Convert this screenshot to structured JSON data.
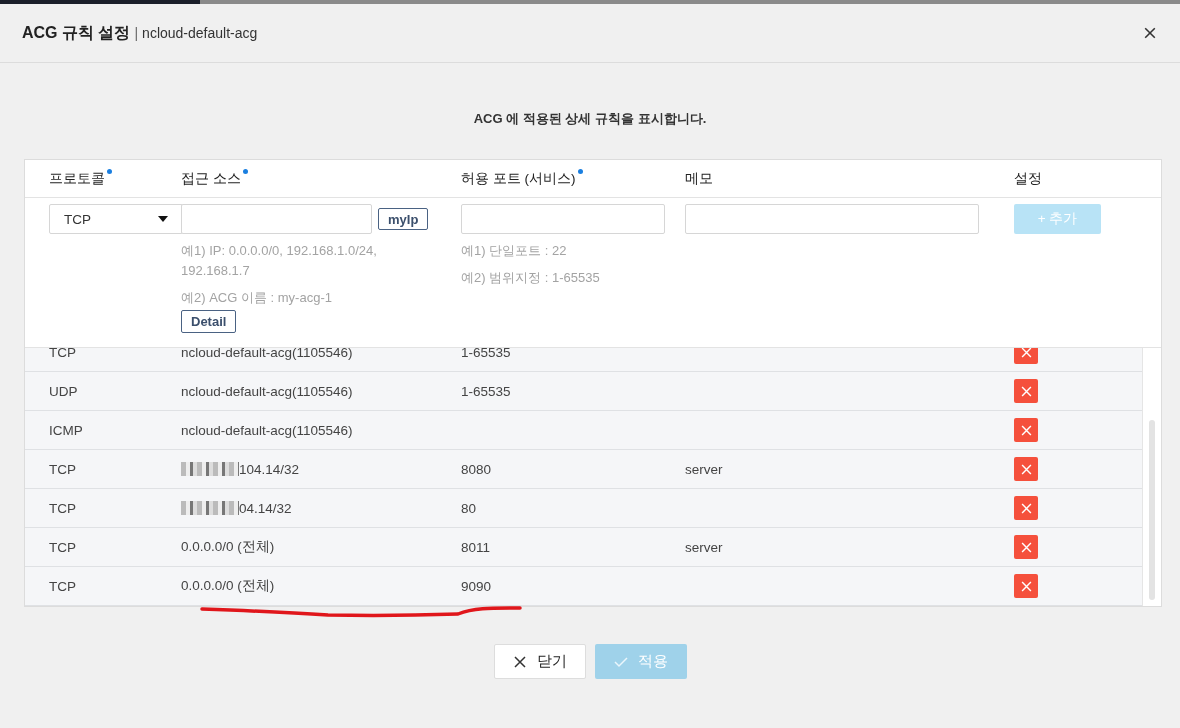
{
  "dialog": {
    "title": "ACG 규칙 설정",
    "separator": "|",
    "subtitle": "ncloud-default-acg",
    "description": "ACG 에 적용된 상세 규칙을 표시합니다."
  },
  "table": {
    "columns": [
      {
        "label": "프로토콜",
        "required": true
      },
      {
        "label": "접근 소스",
        "required": true
      },
      {
        "label": "허용 포트 (서비스)",
        "required": true
      },
      {
        "label": "메모",
        "required": false
      },
      {
        "label": "설정",
        "required": false
      }
    ],
    "form": {
      "protocol": "TCP",
      "myip_button": "myIp",
      "source_hints": [
        "예1) IP: 0.0.0.0/0, 192.168.1.0/24, 192.168.1.7",
        "예2) ACG 이름 : my-acg-1"
      ],
      "detail_button": "Detail",
      "port_hints": [
        "예1) 단일포트 : 22",
        "예2) 범위지정 : 1-65535"
      ],
      "add_button": {
        "label": "+ 추가",
        "disabled": true
      }
    },
    "rows": [
      {
        "protocol": "TCP",
        "source": "ncloud-default-acg(1105546)",
        "redacted": false,
        "port": "1-65535"
      },
      {
        "protocol": "UDP",
        "source": "ncloud-default-acg(1105546)",
        "redacted": false,
        "port": "1-65535"
      },
      {
        "protocol": "ICMP",
        "source": "ncloud-default-acg(1105546)",
        "redacted": false
      },
      {
        "protocol": "TCP",
        "source": "104.14/32",
        "redacted": true,
        "port": "8080",
        "memo": "server"
      },
      {
        "protocol": "TCP",
        "source": "04.14/32",
        "redacted": true,
        "port": "80"
      },
      {
        "protocol": "TCP",
        "source": "0.0.0.0/0 (전체)",
        "redacted": false,
        "port": "8011",
        "memo": "server"
      },
      {
        "protocol": "TCP",
        "source": "0.0.0.0/0 (전체)",
        "redacted": false,
        "port": "9090"
      }
    ]
  },
  "footer": {
    "close_button": {
      "label": "닫기",
      "disabled": false
    },
    "apply_button": {
      "label": "적용",
      "disabled": true
    }
  }
}
